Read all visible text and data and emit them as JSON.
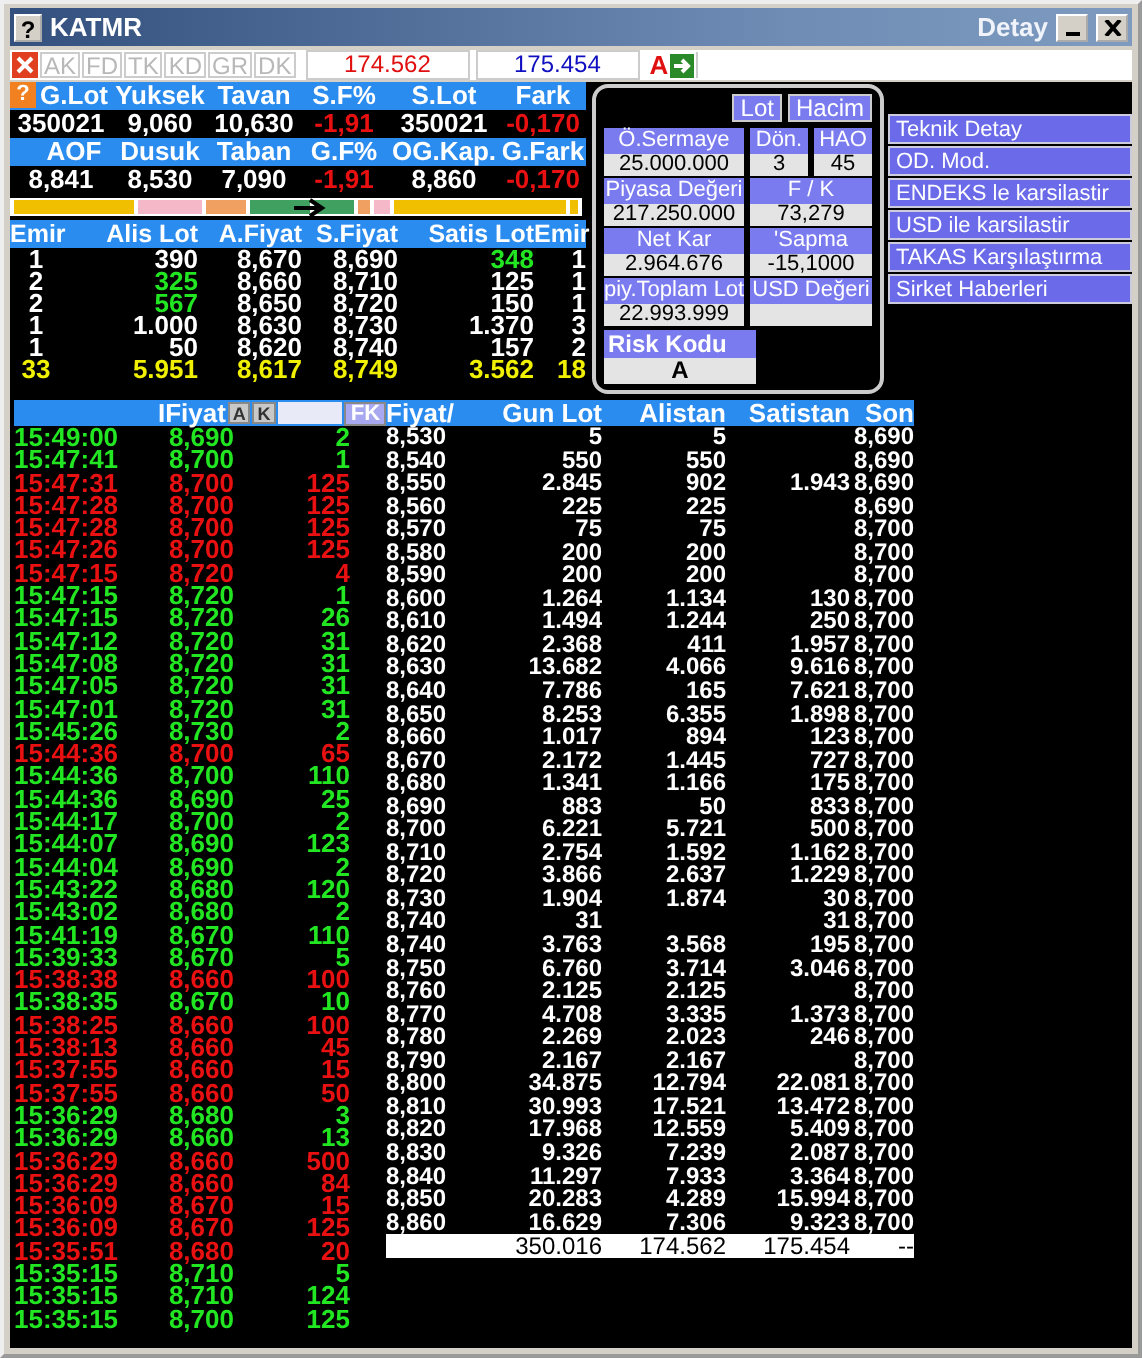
{
  "window": {
    "help_button": "?",
    "title": "KATMR",
    "detail_label": "Detay"
  },
  "stats_help_button": "?",
  "toolbar": {
    "tabs": [
      {
        "label": "AK",
        "disabled": true
      },
      {
        "label": "FD",
        "disabled": true
      },
      {
        "label": "TK",
        "disabled": true
      },
      {
        "label": "KD",
        "disabled": true
      },
      {
        "label": "GR",
        "disabled": true
      },
      {
        "label": "DK",
        "disabled": true
      }
    ],
    "bid_total": "174.562",
    "ask_total": "175.454",
    "risk_letter": "A"
  },
  "stats": [
    [
      {
        "label": "G.Lot",
        "value": "350021",
        "down": false
      },
      {
        "label": "Yuksek",
        "value": "9,060",
        "down": false
      },
      {
        "label": "Tavan",
        "value": "10,630",
        "down": false
      },
      {
        "label": "S.F%",
        "value": "-1,91",
        "down": true
      },
      {
        "label": "S.Lot",
        "value": "350021",
        "down": false
      },
      {
        "label": "Fark",
        "value": "-0,170",
        "down": true
      }
    ],
    [
      {
        "label": "AOF",
        "value": "8,841",
        "down": false
      },
      {
        "label": "Dusuk",
        "value": "8,530",
        "down": false
      },
      {
        "label": "Taban",
        "value": "7,090",
        "down": false
      },
      {
        "label": "G.F%",
        "value": "-1,91",
        "down": true
      },
      {
        "label": "OG.Kap.",
        "value": "8,860",
        "down": false
      },
      {
        "label": "G.Fark",
        "value": "-0,170",
        "down": true
      }
    ]
  ],
  "order_book": {
    "columns": [
      "Emir",
      "Alis Lot",
      "A.Fiyat",
      "S.Fiyat",
      "Satis Lot",
      "Emir"
    ],
    "rows": [
      {
        "bid_orders": "1",
        "bid_lot": "390",
        "bid_lot_changed": false,
        "bid_price": "8,670",
        "ask_price": "8,690",
        "ask_lot": "348",
        "ask_lot_changed": true,
        "ask_orders": "1"
      },
      {
        "bid_orders": "2",
        "bid_lot": "325",
        "bid_lot_changed": true,
        "bid_price": "8,660",
        "ask_price": "8,710",
        "ask_lot": "125",
        "ask_lot_changed": false,
        "ask_orders": "1"
      },
      {
        "bid_orders": "2",
        "bid_lot": "567",
        "bid_lot_changed": true,
        "bid_price": "8,650",
        "ask_price": "8,720",
        "ask_lot": "150",
        "ask_lot_changed": false,
        "ask_orders": "1"
      },
      {
        "bid_orders": "1",
        "bid_lot": "1.000",
        "bid_lot_changed": false,
        "bid_price": "8,630",
        "ask_price": "8,730",
        "ask_lot": "1.370",
        "ask_lot_changed": false,
        "ask_orders": "3"
      },
      {
        "bid_orders": "1",
        "bid_lot": "50",
        "bid_lot_changed": false,
        "bid_price": "8,620",
        "ask_price": "8,740",
        "ask_lot": "157",
        "ask_lot_changed": false,
        "ask_orders": "2"
      }
    ],
    "totals": [
      "33",
      "5.951",
      "8,617",
      "8,749",
      "3.562",
      "18"
    ]
  },
  "info_panel": {
    "buttons": [
      "Lot",
      "Hacim"
    ],
    "rows": [
      [
        {
          "label": "Ö.Sermaye",
          "value": "25.000.000"
        },
        {
          "label": "Dön.",
          "value": "3"
        },
        {
          "label": "HAO",
          "value": "45"
        }
      ],
      [
        {
          "label": "Piyasa Değeri",
          "value": "217.250.000"
        },
        {
          "label": "F / K",
          "value": "73,279"
        }
      ],
      [
        {
          "label": "Net Kar",
          "value": "2.964.676"
        },
        {
          "label": "'Sapma",
          "value": "-15,1000"
        }
      ],
      [
        {
          "label": "piy.Toplam Lot",
          "value": "22.993.999"
        },
        {
          "label": "USD Değeri"
        }
      ]
    ],
    "risk": {
      "label": "Risk Kodu",
      "value": "A"
    }
  },
  "menu": [
    "Teknik Detay",
    "OD. Mod.",
    "ENDEKS le karsilastir",
    "USD ile karsilastir",
    "TAKAS Karşılaştırma",
    "Sirket Haberleri"
  ],
  "trades": {
    "header": "IFiyat",
    "buttons": [
      "A",
      "K"
    ],
    "filter_button": "FK",
    "rows": [
      {
        "time": "15:49:00",
        "price": "8,690",
        "lot": "2",
        "sell": false
      },
      {
        "time": "15:47:41",
        "price": "8,700",
        "lot": "1",
        "sell": false
      },
      {
        "time": "15:47:31",
        "price": "8,700",
        "lot": "125",
        "sell": true
      },
      {
        "time": "15:47:28",
        "price": "8,700",
        "lot": "125",
        "sell": true
      },
      {
        "time": "15:47:28",
        "price": "8,700",
        "lot": "125",
        "sell": true
      },
      {
        "time": "15:47:26",
        "price": "8,700",
        "lot": "125",
        "sell": true
      },
      {
        "time": "15:47:15",
        "price": "8,720",
        "lot": "4",
        "sell": true
      },
      {
        "time": "15:47:15",
        "price": "8,720",
        "lot": "1",
        "sell": false
      },
      {
        "time": "15:47:15",
        "price": "8,720",
        "lot": "26",
        "sell": false
      },
      {
        "time": "15:47:12",
        "price": "8,720",
        "lot": "31",
        "sell": false
      },
      {
        "time": "15:47:08",
        "price": "8,720",
        "lot": "31",
        "sell": false
      },
      {
        "time": "15:47:05",
        "price": "8,720",
        "lot": "31",
        "sell": false
      },
      {
        "time": "15:47:01",
        "price": "8,720",
        "lot": "31",
        "sell": false
      },
      {
        "time": "15:45:26",
        "price": "8,730",
        "lot": "2",
        "sell": false
      },
      {
        "time": "15:44:36",
        "price": "8,700",
        "lot": "65",
        "sell": true
      },
      {
        "time": "15:44:36",
        "price": "8,700",
        "lot": "110",
        "sell": false
      },
      {
        "time": "15:44:36",
        "price": "8,690",
        "lot": "25",
        "sell": false
      },
      {
        "time": "15:44:17",
        "price": "8,700",
        "lot": "2",
        "sell": false
      },
      {
        "time": "15:44:07",
        "price": "8,690",
        "lot": "123",
        "sell": false
      },
      {
        "time": "15:44:04",
        "price": "8,690",
        "lot": "2",
        "sell": false
      },
      {
        "time": "15:43:22",
        "price": "8,680",
        "lot": "120",
        "sell": false
      },
      {
        "time": "15:43:02",
        "price": "8,680",
        "lot": "2",
        "sell": false
      },
      {
        "time": "15:41:19",
        "price": "8,670",
        "lot": "110",
        "sell": false
      },
      {
        "time": "15:39:33",
        "price": "8,670",
        "lot": "5",
        "sell": false
      },
      {
        "time": "15:38:38",
        "price": "8,660",
        "lot": "100",
        "sell": true
      },
      {
        "time": "15:38:35",
        "price": "8,670",
        "lot": "10",
        "sell": false
      },
      {
        "time": "15:38:25",
        "price": "8,660",
        "lot": "100",
        "sell": true
      },
      {
        "time": "15:38:13",
        "price": "8,660",
        "lot": "45",
        "sell": true
      },
      {
        "time": "15:37:55",
        "price": "8,660",
        "lot": "15",
        "sell": true
      },
      {
        "time": "15:37:55",
        "price": "8,660",
        "lot": "50",
        "sell": true
      },
      {
        "time": "15:36:29",
        "price": "8,680",
        "lot": "3",
        "sell": false
      },
      {
        "time": "15:36:29",
        "price": "8,660",
        "lot": "13",
        "sell": false
      },
      {
        "time": "15:36:29",
        "price": "8,660",
        "lot": "500",
        "sell": true
      },
      {
        "time": "15:36:29",
        "price": "8,660",
        "lot": "84",
        "sell": true
      },
      {
        "time": "15:36:09",
        "price": "8,670",
        "lot": "15",
        "sell": true
      },
      {
        "time": "15:36:09",
        "price": "8,670",
        "lot": "125",
        "sell": true
      },
      {
        "time": "15:35:51",
        "price": "8,680",
        "lot": "20",
        "sell": true
      },
      {
        "time": "15:35:15",
        "price": "8,710",
        "lot": "5",
        "sell": false
      },
      {
        "time": "15:35:15",
        "price": "8,710",
        "lot": "124",
        "sell": false
      },
      {
        "time": "15:35:15",
        "price": "8,700",
        "lot": "125",
        "sell": false
      }
    ]
  },
  "price_table": {
    "columns": [
      "Fiyat/",
      "Gun Lot",
      "Alistan",
      "Satistan",
      "Son"
    ],
    "rows": [
      [
        "8,530",
        "5",
        "5",
        "",
        "8,690"
      ],
      [
        "8,540",
        "550",
        "550",
        "",
        "8,690"
      ],
      [
        "8,550",
        "2.845",
        "902",
        "1.943",
        "8,690"
      ],
      [
        "8,560",
        "225",
        "225",
        "",
        "8,690"
      ],
      [
        "8,570",
        "75",
        "75",
        "",
        "8,700"
      ],
      [
        "8,580",
        "200",
        "200",
        "",
        "8,700"
      ],
      [
        "8,590",
        "200",
        "200",
        "",
        "8,700"
      ],
      [
        "8,600",
        "1.264",
        "1.134",
        "130",
        "8,700"
      ],
      [
        "8,610",
        "1.494",
        "1.244",
        "250",
        "8,700"
      ],
      [
        "8,620",
        "2.368",
        "411",
        "1.957",
        "8,700"
      ],
      [
        "8,630",
        "13.682",
        "4.066",
        "9.616",
        "8,700"
      ],
      [
        "8,640",
        "7.786",
        "165",
        "7.621",
        "8,700"
      ],
      [
        "8,650",
        "8.253",
        "6.355",
        "1.898",
        "8,700"
      ],
      [
        "8,660",
        "1.017",
        "894",
        "123",
        "8,700"
      ],
      [
        "8,670",
        "2.172",
        "1.445",
        "727",
        "8,700"
      ],
      [
        "8,680",
        "1.341",
        "1.166",
        "175",
        "8,700"
      ],
      [
        "8,690",
        "883",
        "50",
        "833",
        "8,700"
      ],
      [
        "8,700",
        "6.221",
        "5.721",
        "500",
        "8,700"
      ],
      [
        "8,710",
        "2.754",
        "1.592",
        "1.162",
        "8,700"
      ],
      [
        "8,720",
        "3.866",
        "2.637",
        "1.229",
        "8,700"
      ],
      [
        "8,730",
        "1.904",
        "1.874",
        "30",
        "8,700"
      ],
      [
        "8,740",
        "31",
        "",
        "31",
        "8,700"
      ],
      [
        "8,740",
        "3.763",
        "3.568",
        "195",
        "8,700"
      ],
      [
        "8,750",
        "6.760",
        "3.714",
        "3.046",
        "8,700"
      ],
      [
        "8,760",
        "2.125",
        "2.125",
        "",
        "8,700"
      ],
      [
        "8,770",
        "4.708",
        "3.335",
        "1.373",
        "8,700"
      ],
      [
        "8,780",
        "2.269",
        "2.023",
        "246",
        "8,700"
      ],
      [
        "8,790",
        "2.167",
        "2.167",
        "",
        "8,700"
      ],
      [
        "8,800",
        "34.875",
        "12.794",
        "22.081",
        "8,700"
      ],
      [
        "8,810",
        "30.993",
        "17.521",
        "13.472",
        "8,700"
      ],
      [
        "8,820",
        "17.968",
        "12.559",
        "5.409",
        "8,700"
      ],
      [
        "8,830",
        "9.326",
        "7.239",
        "2.087",
        "8,700"
      ],
      [
        "8,840",
        "11.297",
        "7.933",
        "3.364",
        "8,700"
      ],
      [
        "8,850",
        "20.283",
        "4.289",
        "15.994",
        "8,700"
      ],
      [
        "8,860",
        "16.629",
        "7.306",
        "9.323",
        "8,700"
      ]
    ],
    "totals": [
      "350.016",
      "174.562",
      "175.454",
      "--"
    ]
  }
}
